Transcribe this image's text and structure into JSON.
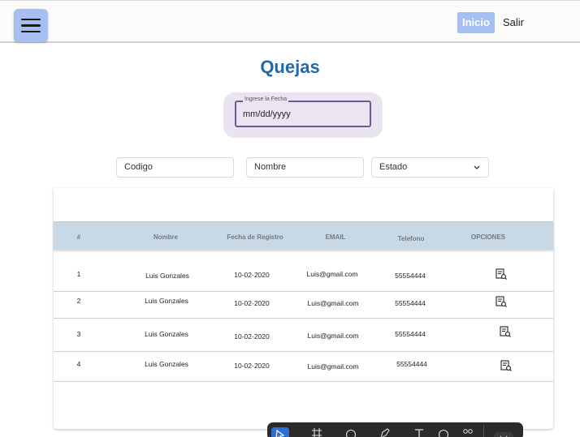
{
  "header": {
    "menu_icon": "hamburger-menu-icon",
    "inicio_label": "Inicio",
    "salir_label": "Salir"
  },
  "page": {
    "title": "Quejas"
  },
  "date_filter": {
    "label": "Ingrese la Fecha",
    "value": "mm/dd/yyyy"
  },
  "filters": {
    "codigo_placeholder": "Codigo",
    "nombre_placeholder": "Nombre",
    "estado_value": "Estado"
  },
  "table": {
    "columns": [
      "#",
      "Nombre",
      "Fecha de Registro",
      "EMAIL",
      "Telefono",
      "OPCIONES"
    ],
    "rows": [
      {
        "num": "1",
        "nombre": "Luis Gonzales",
        "fecha": "10-02-2020",
        "email": "Luis@gmail.com",
        "telefono": "55554444"
      },
      {
        "num": "2",
        "nombre": "Luis Gonzales",
        "fecha": "10-02-2020",
        "email": "Luis@gmail.com",
        "telefono": "55554444"
      },
      {
        "num": "3",
        "nombre": "Luis Gonzales",
        "fecha": "10-02-2020",
        "email": "Luis@gmail.com",
        "telefono": "55554444"
      },
      {
        "num": "4",
        "nombre": "Luis Gonzales",
        "fecha": "10-02-2020",
        "email": "Luis@gmail.com",
        "telefono": "55554444"
      }
    ],
    "option_icon": "document-search-icon"
  },
  "colors": {
    "accent": "#a5bff3",
    "title": "#1f6aa7",
    "table_header": "#c8d9e5",
    "date_border": "#6b5b95"
  }
}
